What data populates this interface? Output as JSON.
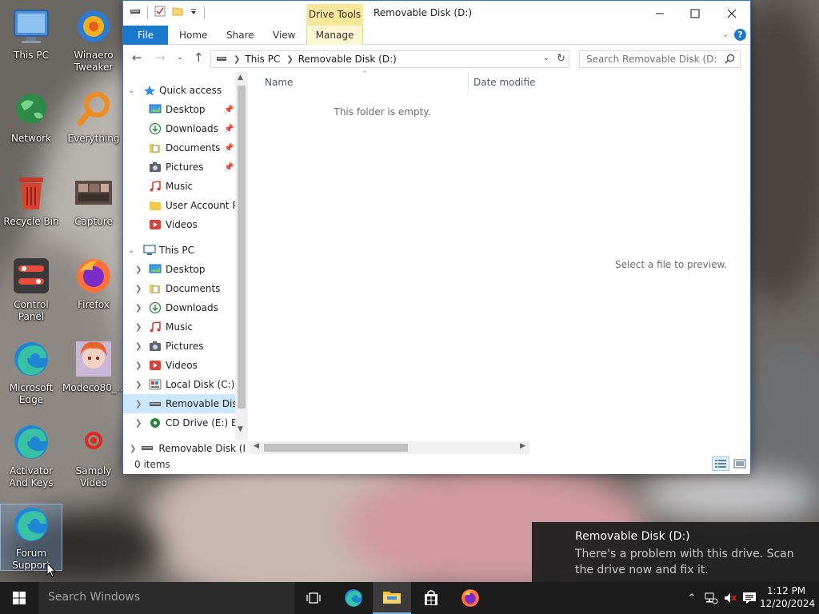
{
  "desktop": {
    "icons": [
      {
        "label": "This PC"
      },
      {
        "label": "Winaero Tweaker"
      },
      {
        "label": "Network"
      },
      {
        "label": "Everything"
      },
      {
        "label": "Recycle Bin"
      },
      {
        "label": "Capture"
      },
      {
        "label": "Control Panel"
      },
      {
        "label": "Firefox"
      },
      {
        "label": "Microsoft Edge"
      },
      {
        "label": "Modeco80_..."
      },
      {
        "label": "Activator And Keys"
      },
      {
        "label": "Samply Video"
      },
      {
        "label": "Forum Support"
      }
    ]
  },
  "window": {
    "title": "Removable Disk (D:)",
    "contextual_tab_group": "Drive Tools",
    "ribbon_tabs": [
      "File",
      "Home",
      "Share",
      "View",
      "Manage"
    ],
    "address": {
      "root": "This PC",
      "current": "Removable Disk (D:)"
    },
    "search_placeholder": "Search Removable Disk (D:)",
    "nav_pane": {
      "quick_access_label": "Quick access",
      "quick_access_items": [
        {
          "label": "Desktop",
          "pinned": true
        },
        {
          "label": "Downloads",
          "pinned": true
        },
        {
          "label": "Documents",
          "pinned": true
        },
        {
          "label": "Pictures",
          "pinned": true
        },
        {
          "label": "Music",
          "pinned": false
        },
        {
          "label": "User Account Pi",
          "pinned": false
        },
        {
          "label": "Videos",
          "pinned": false
        }
      ],
      "this_pc_label": "This PC",
      "this_pc_items": [
        {
          "label": "Desktop"
        },
        {
          "label": "Documents"
        },
        {
          "label": "Downloads"
        },
        {
          "label": "Music"
        },
        {
          "label": "Pictures"
        },
        {
          "label": "Videos"
        },
        {
          "label": "Local Disk (C:)"
        },
        {
          "label": "Removable Disk",
          "selected": true
        },
        {
          "label": "CD Drive (E:) ESD"
        }
      ],
      "bottom_item": "Removable Disk (I"
    },
    "columns": {
      "name": "Name",
      "date": "Date modifie"
    },
    "empty_message": "This folder is empty.",
    "preview_message": "Select a file to preview.",
    "status": "0 items"
  },
  "toast": {
    "title": "Removable Disk (D:)",
    "message": "There's a problem with this drive.  Scan the drive now and fix it."
  },
  "taskbar": {
    "search_placeholder": "Search Windows",
    "time": "1:12 PM",
    "date": "12/20/2024"
  },
  "colors": {
    "accent": "#1979ca",
    "drive_tools": "#f6e79a",
    "selection": "#cce8ff",
    "taskbar": "#1b1b1b"
  }
}
